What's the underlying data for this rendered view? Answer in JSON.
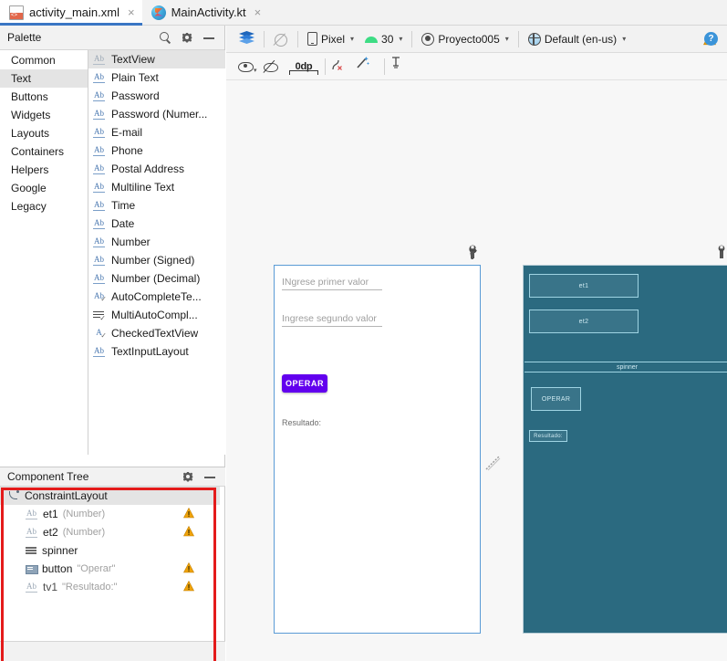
{
  "tabs": [
    {
      "label": "activity_main.xml",
      "icon": "xml-file-icon",
      "active": true,
      "close": "×"
    },
    {
      "label": "MainActivity.kt",
      "icon": "kotlin-file-icon",
      "active": false,
      "close": "×"
    }
  ],
  "palette": {
    "title": "Palette",
    "icons": {
      "search": "search-icon",
      "gear": "gear-icon",
      "minimize": "minimize-icon"
    },
    "categories": [
      {
        "label": "Common",
        "selected": false
      },
      {
        "label": "Text",
        "selected": true
      },
      {
        "label": "Buttons",
        "selected": false
      },
      {
        "label": "Widgets",
        "selected": false
      },
      {
        "label": "Layouts",
        "selected": false
      },
      {
        "label": "Containers",
        "selected": false
      },
      {
        "label": "Helpers",
        "selected": false
      },
      {
        "label": "Google",
        "selected": false
      },
      {
        "label": "Legacy",
        "selected": false
      }
    ],
    "items": [
      {
        "label": "TextView",
        "icon": "ab-icon",
        "selected": true,
        "dim": true
      },
      {
        "label": "Plain Text",
        "icon": "ab-icon",
        "selected": false,
        "dim": false
      },
      {
        "label": "Password",
        "icon": "ab-icon",
        "selected": false,
        "dim": false
      },
      {
        "label": "Password (Numer...",
        "icon": "ab-icon",
        "selected": false,
        "dim": false
      },
      {
        "label": "E-mail",
        "icon": "ab-icon",
        "selected": false,
        "dim": false
      },
      {
        "label": "Phone",
        "icon": "ab-icon",
        "selected": false,
        "dim": false
      },
      {
        "label": "Postal Address",
        "icon": "ab-icon",
        "selected": false,
        "dim": false
      },
      {
        "label": "Multiline Text",
        "icon": "ab-icon",
        "selected": false,
        "dim": false
      },
      {
        "label": "Time",
        "icon": "ab-icon",
        "selected": false,
        "dim": false
      },
      {
        "label": "Date",
        "icon": "ab-icon",
        "selected": false,
        "dim": false
      },
      {
        "label": "Number",
        "icon": "ab-icon",
        "selected": false,
        "dim": false
      },
      {
        "label": "Number (Signed)",
        "icon": "ab-icon",
        "selected": false,
        "dim": false
      },
      {
        "label": "Number (Decimal)",
        "icon": "ab-icon",
        "selected": false,
        "dim": false
      },
      {
        "label": "AutoCompleteTe...",
        "icon": "ab-check-icon",
        "selected": false,
        "dim": false
      },
      {
        "label": "MultiAutoCompl...",
        "icon": "multiline-check-icon",
        "selected": false,
        "dim": false
      },
      {
        "label": "CheckedTextView",
        "icon": "a-check-icon",
        "selected": false,
        "dim": false
      },
      {
        "label": "TextInputLayout",
        "icon": "ab-icon",
        "selected": false,
        "dim": false
      }
    ]
  },
  "component_tree": {
    "title": "Component Tree",
    "icons": {
      "gear": "gear-icon",
      "minimize": "minimize-icon"
    },
    "rows": [
      {
        "name": "ConstraintLayout",
        "attr": "",
        "icon": "constraint-layout-icon",
        "selected": true,
        "warning": false,
        "indent": 0
      },
      {
        "name": "et1",
        "attr": "(Number)",
        "icon": "ab-icon",
        "selected": false,
        "warning": true,
        "indent": 1
      },
      {
        "name": "et2",
        "attr": "(Number)",
        "icon": "ab-icon",
        "selected": false,
        "warning": true,
        "indent": 1
      },
      {
        "name": "spinner",
        "attr": "",
        "icon": "spinner-icon",
        "selected": false,
        "warning": false,
        "indent": 1
      },
      {
        "name": "button",
        "attr": "\"Operar\"",
        "icon": "button-icon",
        "selected": false,
        "warning": true,
        "indent": 1
      },
      {
        "name": "tv1",
        "attr": "\"Resultado:\"",
        "icon": "ab-icon",
        "selected": false,
        "warning": true,
        "indent": 1
      }
    ]
  },
  "design_toolbar": {
    "layers_icon": "layers-icon",
    "blueprint_icon": "blueprint-off-icon",
    "device": {
      "label": "Pixel",
      "icon": "phone-icon",
      "caret": "⌄"
    },
    "api": {
      "label": "30",
      "icon": "android-icon",
      "caret": "⌄"
    },
    "theme": {
      "label": "Proyecto005",
      "icon": "theme-icon",
      "caret": "⌄"
    },
    "locale": {
      "label": "Default (en-us)",
      "icon": "globe-icon",
      "caret": "⌄"
    },
    "warning_icon": "warning-icon"
  },
  "constraint_toolbar": {
    "view_options_icon": "eye-icon",
    "toggle_constraints_icon": "hide-constraints-icon",
    "margin_value": "0dp",
    "clear_constraints_icon": "clear-constraints-icon",
    "infer_constraints_icon": "infer-constraints-icon",
    "align_icon": "baseline-align-icon",
    "help_icon": "help-icon",
    "help_label": "?"
  },
  "preview": {
    "wrench_icon": "wrench-icon",
    "render": {
      "edit1_hint": "INgrese primer valor",
      "edit2_hint": "Ingrese segundo valor",
      "button_label": "OPERAR",
      "result_label": "Resultado:"
    },
    "blueprint": {
      "et1": "et1",
      "et2": "et2",
      "spinner": "spinner",
      "button_label": "OPERAR",
      "result_label": "Resultado:"
    }
  },
  "colors": {
    "accent_purple": "#6200EE",
    "blueprint_bg": "#2b6a80",
    "blueprint_stroke": "#9fd4e3",
    "tab_underline": "#3a76c4",
    "annotation_red": "#e41b1b",
    "warning_amber": "#f0a30a",
    "android_green": "#3ddc84"
  }
}
